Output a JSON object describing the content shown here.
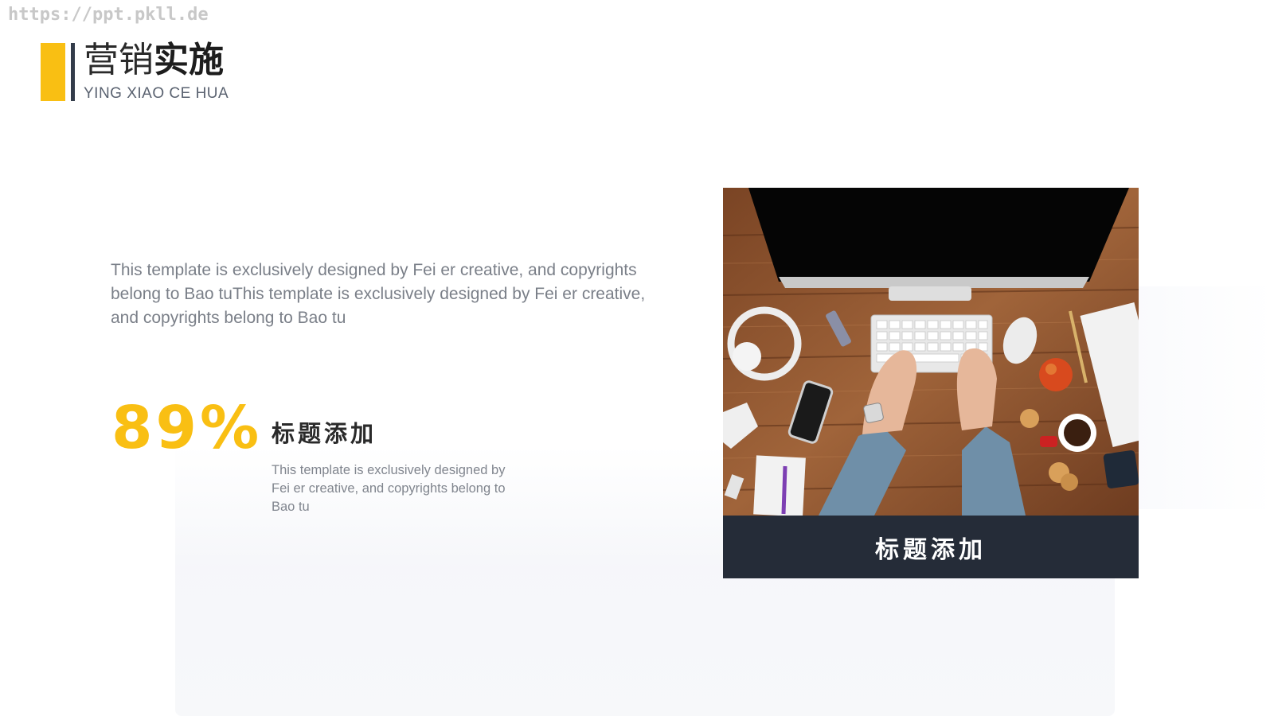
{
  "watermark": "https://ppt.pkll.de",
  "header": {
    "title_light": "营销",
    "title_bold": "实施",
    "subtitle": "YING XIAO CE HUA"
  },
  "intro": {
    "text": "This template is exclusively designed by Fei er creative, and copyrights belong to Bao tuThis template is exclusively designed by Fei er creative, and copyrights belong to Bao tu"
  },
  "stat": {
    "value": "89%",
    "heading": "标题添加",
    "description": "This template is exclusively designed by Fei er creative, and copyrights belong to Bao tu"
  },
  "photo_card": {
    "caption": "标题添加"
  },
  "colors": {
    "accent": "#f9bf13",
    "dark": "#252c38",
    "title_bar_dark": "#333c4a",
    "body_text": "#7a7f88"
  }
}
